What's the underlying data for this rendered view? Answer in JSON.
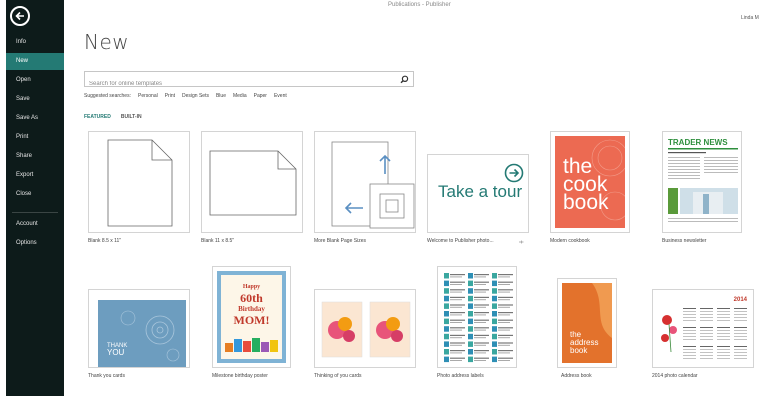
{
  "window": {
    "title": "Publications - Publisher",
    "user": "Linda M"
  },
  "sidebar": {
    "items": [
      {
        "label": "Info"
      },
      {
        "label": "New"
      },
      {
        "label": "Open"
      },
      {
        "label": "Save"
      },
      {
        "label": "Save As"
      },
      {
        "label": "Print"
      },
      {
        "label": "Share"
      },
      {
        "label": "Export"
      },
      {
        "label": "Close"
      },
      {
        "label": "Account"
      },
      {
        "label": "Options"
      }
    ]
  },
  "main": {
    "title": "New",
    "search": {
      "placeholder": "Search for online templates"
    },
    "suggested": {
      "label": "Suggested searches:",
      "items": [
        "Personal",
        "Print",
        "Design Sets",
        "Blue",
        "Media",
        "Paper",
        "Event"
      ]
    },
    "tabs": [
      {
        "label": "FEATURED"
      },
      {
        "label": "BUILT-IN"
      }
    ],
    "templates": [
      {
        "caption": "Blank 8.5 x 11\""
      },
      {
        "caption": "Blank 11 x 8.5\""
      },
      {
        "caption": "More Blank Page Sizes"
      },
      {
        "caption": "Welcome to Publisher photo...",
        "tile_text": "Take a tour"
      },
      {
        "caption": "Modern cookbook",
        "tile_text_1": "the",
        "tile_text_2": "cook",
        "tile_text_3": "book"
      },
      {
        "caption": "Business newsletter",
        "tile_text": "TRADER NEWS"
      },
      {
        "caption": "Thank you cards",
        "tile_text_1": "THANK",
        "tile_text_2": "YOU"
      },
      {
        "caption": "Milestone birthday poster",
        "tile_text_1": "Happy",
        "tile_text_2": "60th",
        "tile_text_3": "Birthday",
        "tile_text_4": "MOM!"
      },
      {
        "caption": "Thinking of you cards"
      },
      {
        "caption": "Photo address labels"
      },
      {
        "caption": "Address book",
        "tile_text_1": "the",
        "tile_text_2": "address",
        "tile_text_3": "book"
      },
      {
        "caption": "2014 photo calendar",
        "tile_text": "2014"
      }
    ]
  },
  "colors": {
    "accent": "#247a74",
    "sidebar_bg": "#0d1b1a",
    "cookbook": "#ec6a52",
    "address_book": "#e3722c"
  }
}
